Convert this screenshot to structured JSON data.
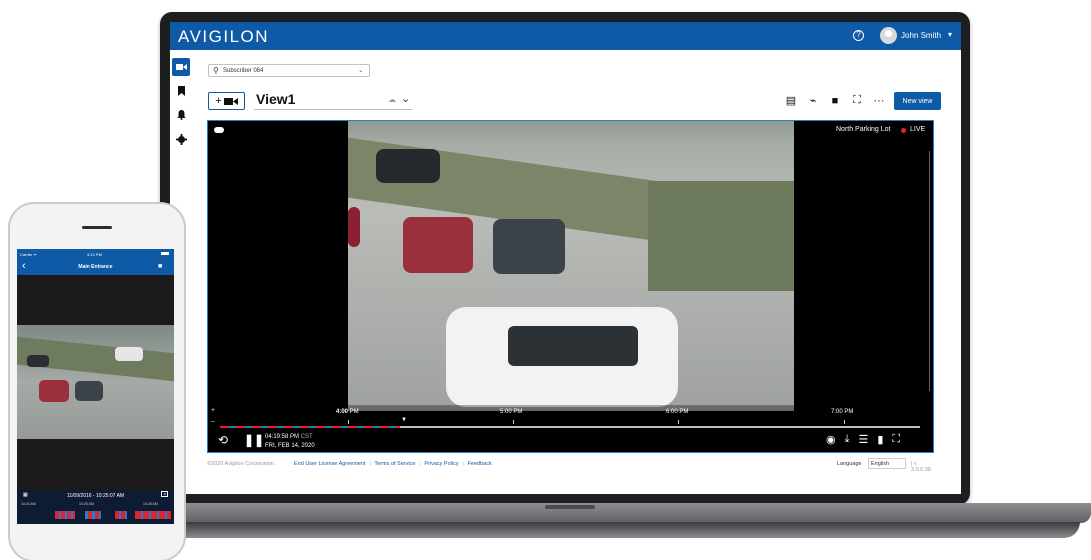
{
  "desktop": {
    "app": {
      "logo": "AVIGILON",
      "user_name": "John Smith",
      "help_icon": "help-circle-icon",
      "user_caret": "▾",
      "brand_color": "#0f5aa6"
    },
    "sidebar": {
      "items": [
        {
          "name": "video-camera-icon",
          "glyph": "■",
          "active": true
        },
        {
          "name": "bookmark-icon",
          "glyph": "▮",
          "active": false
        },
        {
          "name": "bell-icon",
          "glyph": "▲",
          "active": false
        },
        {
          "name": "gear-icon",
          "glyph": "⚙",
          "active": false
        }
      ]
    },
    "search": {
      "value": "Subscriber 084",
      "icon": "search-icon"
    },
    "view": {
      "add_camera_label": "+■◂",
      "title": "View1",
      "cloud_icon": "☁",
      "caret": "⌄",
      "new_view_label": "New view"
    },
    "toolbar": {
      "icons": [
        "layout-icon",
        "link-off-icon",
        "square-icon",
        "fullscreen-icon",
        "more-icon"
      ],
      "glyphs": [
        "▤",
        "⌁",
        "■",
        "⛶",
        "···"
      ]
    },
    "tile": {
      "camera_name": "North Parking Lot",
      "live_label": "LIVE",
      "live_color": "#e0222b"
    },
    "timeline": {
      "labels": [
        {
          "bold": "4:00",
          "rest": " PM"
        },
        {
          "bold": "",
          "rest": "5:00 PM"
        },
        {
          "bold": "",
          "rest": "6:00 PM"
        },
        {
          "bold": "",
          "rest": "7:00 PM"
        }
      ],
      "zoom_in": "+",
      "zoom_out": "–",
      "rewind_icon": "⟲",
      "pause_icon": "❚❚",
      "time": "04:19:58 PM",
      "timezone": "CST",
      "date": "FRI, FEB 14, 2020",
      "controls": [
        "camera-snapshot-icon",
        "download-icon",
        "adjust-icon",
        "bookmark-add-icon",
        "fullscreen-icon"
      ],
      "control_glyphs": [
        "◉",
        "⤓",
        "☰",
        "▮",
        "⛶"
      ]
    },
    "footer": {
      "copyright": "©2020 Avigilon Corporation.",
      "links": [
        "End User License Agreement",
        "Terms of Service",
        "Privacy Policy",
        "Feedback"
      ],
      "language_label": "Language",
      "language_value": "English",
      "version": "| v 3.0.0.38"
    }
  },
  "mobile": {
    "status": {
      "carrier": "Carrier ᯤ",
      "time": "4:13 PM"
    },
    "nav": {
      "back": "‹",
      "title": "Main Entrance",
      "cam_icon": "■"
    },
    "playback": {
      "date": "11/09/2016 - 10:25:07 AM",
      "ticks": [
        "10:24 AM",
        "10:25 AM",
        "10:26 AM"
      ]
    }
  }
}
